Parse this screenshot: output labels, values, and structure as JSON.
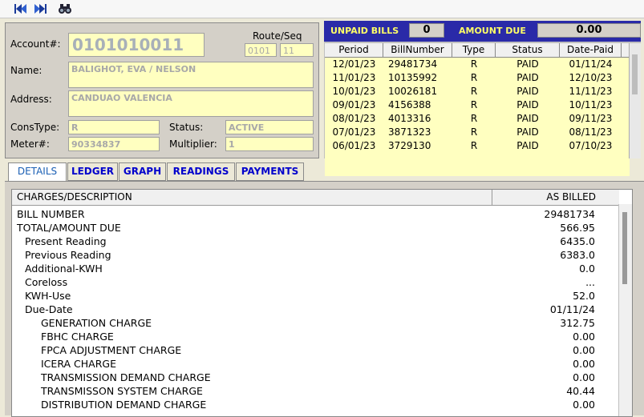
{
  "toolbar": {
    "icons": [
      "first-record-icon",
      "next-record-icon",
      "search-binoculars-icon"
    ]
  },
  "account": {
    "account_label": "Account#:",
    "account_number": "0101010011",
    "route_label": "Route/Seq",
    "route": "0101",
    "seq": "11",
    "name_label": "Name:",
    "name": "BALIGHOT, EVA / NELSON",
    "address_label": "Address:",
    "address": "CANDUAO VALENCIA",
    "constype_label": "ConsType:",
    "constype": "R",
    "status_label": "Status:",
    "status": "ACTIVE",
    "meter_label": "Meter#:",
    "meter": "90334837",
    "multiplier_label": "Multiplier:",
    "multiplier": "1"
  },
  "bills": {
    "unpaid_label": "UNPAID BILLS",
    "unpaid_count": "0",
    "amount_label": "AMOUNT DUE",
    "amount_due": "0.00",
    "columns": [
      "Period",
      "BillNumber",
      "Type",
      "Status",
      "Date-Paid"
    ],
    "rows": [
      [
        "12/01/23",
        "29481734",
        "R",
        "PAID",
        "01/11/24"
      ],
      [
        "11/01/23",
        "10135992",
        "R",
        "PAID",
        "12/10/23"
      ],
      [
        "10/01/23",
        "10026181",
        "R",
        "PAID",
        "11/11/23"
      ],
      [
        "09/01/23",
        "4156388",
        "R",
        "PAID",
        "10/11/23"
      ],
      [
        "08/01/23",
        "4013316",
        "R",
        "PAID",
        "09/11/23"
      ],
      [
        "07/01/23",
        "3871323",
        "R",
        "PAID",
        "08/11/23"
      ],
      [
        "06/01/23",
        "3729130",
        "R",
        "PAID",
        "07/10/23"
      ]
    ]
  },
  "tabs": [
    "DETAILS",
    "LEDGER",
    "GRAPH",
    "READINGS",
    "PAYMENTS"
  ],
  "charges": {
    "col_desc": "CHARGES/DESCRIPTION",
    "col_value": "AS BILLED",
    "rows": [
      {
        "label": "BILL NUMBER",
        "value": "29481734",
        "indent": 0
      },
      {
        "label": "TOTAL/AMOUNT DUE",
        "value": "566.95",
        "indent": 0
      },
      {
        "label": "Present Reading",
        "value": "6435.0",
        "indent": 1
      },
      {
        "label": "Previous Reading",
        "value": "6383.0",
        "indent": 1
      },
      {
        "label": "Additional-KWH",
        "value": "0.0",
        "indent": 1
      },
      {
        "label": "Coreloss",
        "value": "...",
        "indent": 1
      },
      {
        "label": "KWH-Use",
        "value": "52.0",
        "indent": 1
      },
      {
        "label": "Due-Date",
        "value": "01/11/24",
        "indent": 1
      },
      {
        "label": "GENERATION CHARGE",
        "value": "312.75",
        "indent": 2
      },
      {
        "label": "FBHC CHARGE",
        "value": "0.00",
        "indent": 2
      },
      {
        "label": "FPCA ADJUSTMENT CHARGE",
        "value": "0.00",
        "indent": 2
      },
      {
        "label": "ICERA CHARGE",
        "value": "0.00",
        "indent": 2
      },
      {
        "label": "TRANSMISSION DEMAND CHARGE",
        "value": "0.00",
        "indent": 2
      },
      {
        "label": "TRANSMISSON SYSTEM CHARGE",
        "value": "40.44",
        "indent": 2
      },
      {
        "label": "DISTRIBUTION DEMAND CHARGE",
        "value": "0.00",
        "indent": 2
      }
    ]
  }
}
